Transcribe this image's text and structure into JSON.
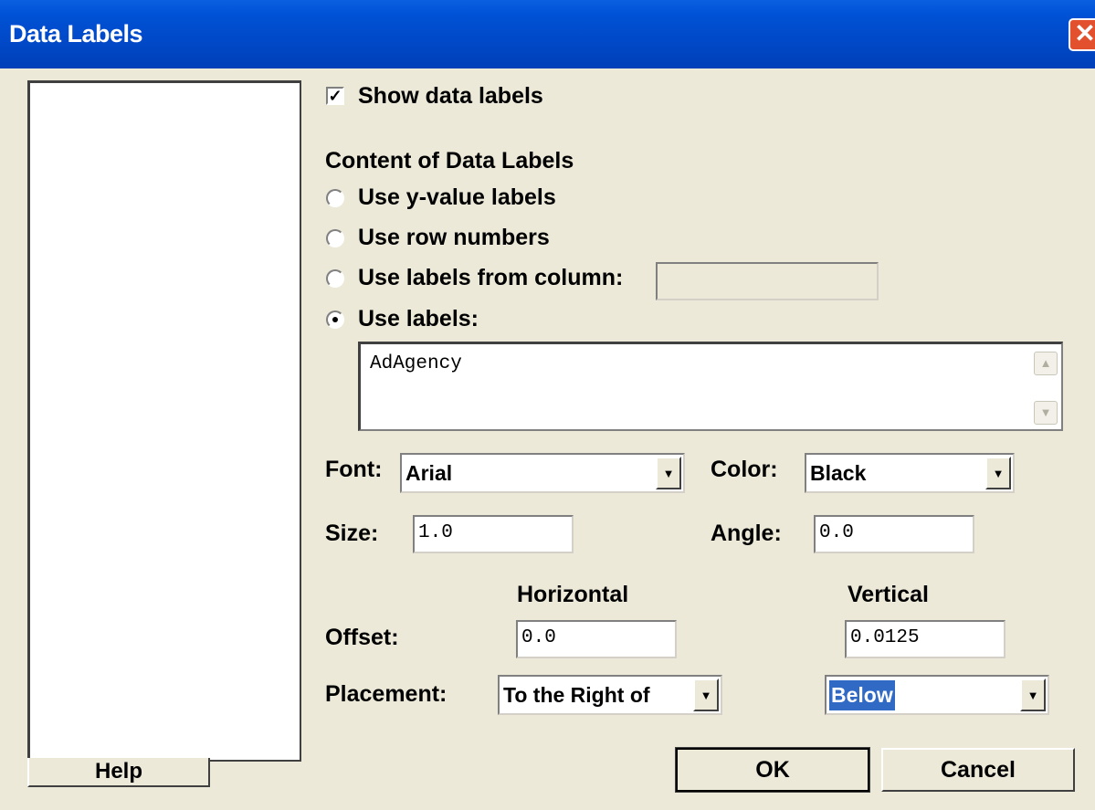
{
  "window": {
    "title": "Data Labels",
    "close_glyph": "✕"
  },
  "show_data_labels": {
    "label": "Show data labels",
    "checked": true,
    "check_glyph": "✓"
  },
  "content": {
    "heading": "Content of Data Labels",
    "options": [
      {
        "label": "Use y-value labels",
        "selected": false
      },
      {
        "label": "Use row numbers",
        "selected": false
      },
      {
        "label": "Use labels from column:",
        "selected": false
      },
      {
        "label": "Use labels:",
        "selected": true
      }
    ],
    "column_field_value": "",
    "labels_text": "AdAgency"
  },
  "font": {
    "label": "Font:",
    "value": "Arial"
  },
  "color": {
    "label": "Color:",
    "value": "Black"
  },
  "size": {
    "label": "Size:",
    "value": "1.0"
  },
  "angle": {
    "label": "Angle:",
    "value": "0.0"
  },
  "offset": {
    "label": "Offset:",
    "horizontal_header": "Horizontal",
    "vertical_header": "Vertical",
    "horizontal_value": "0.0",
    "vertical_value": "0.0125"
  },
  "placement": {
    "label": "Placement:",
    "horizontal_value": "To the Right of",
    "vertical_value": "Below"
  },
  "buttons": {
    "help": "Help",
    "ok": "OK",
    "cancel": "Cancel"
  },
  "icons": {
    "dropdown_arrow": "▼",
    "scroll_up": "▲",
    "scroll_down": "▼"
  },
  "colors": {
    "title_bar": "#0052d6",
    "dialog_bg": "#ece9d8",
    "selection": "#316ac5",
    "close_button": "#e2502d"
  }
}
